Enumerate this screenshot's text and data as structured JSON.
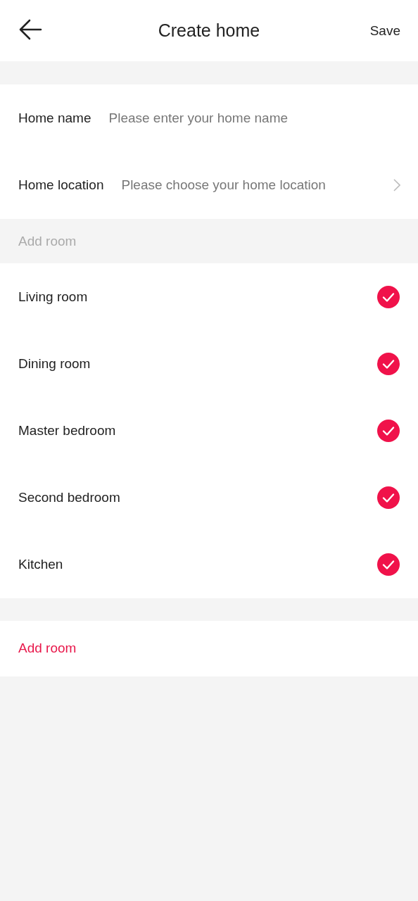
{
  "header": {
    "title": "Create home",
    "action": "Save"
  },
  "fields": [
    {
      "kind": "input",
      "label": "Home name",
      "placeholder": "Please enter your home name"
    },
    {
      "kind": "picker",
      "label": "Home location",
      "placeholder": "Please choose your home location"
    }
  ],
  "rooms_section": {
    "title": "Add room"
  },
  "rooms": [
    {
      "name": "Living room",
      "checked": true
    },
    {
      "name": "Dining room",
      "checked": true
    },
    {
      "name": "Master bedroom",
      "checked": true
    },
    {
      "name": "Second bedroom",
      "checked": true
    },
    {
      "name": "Kitchen",
      "checked": true
    }
  ],
  "add_room": "Add room"
}
